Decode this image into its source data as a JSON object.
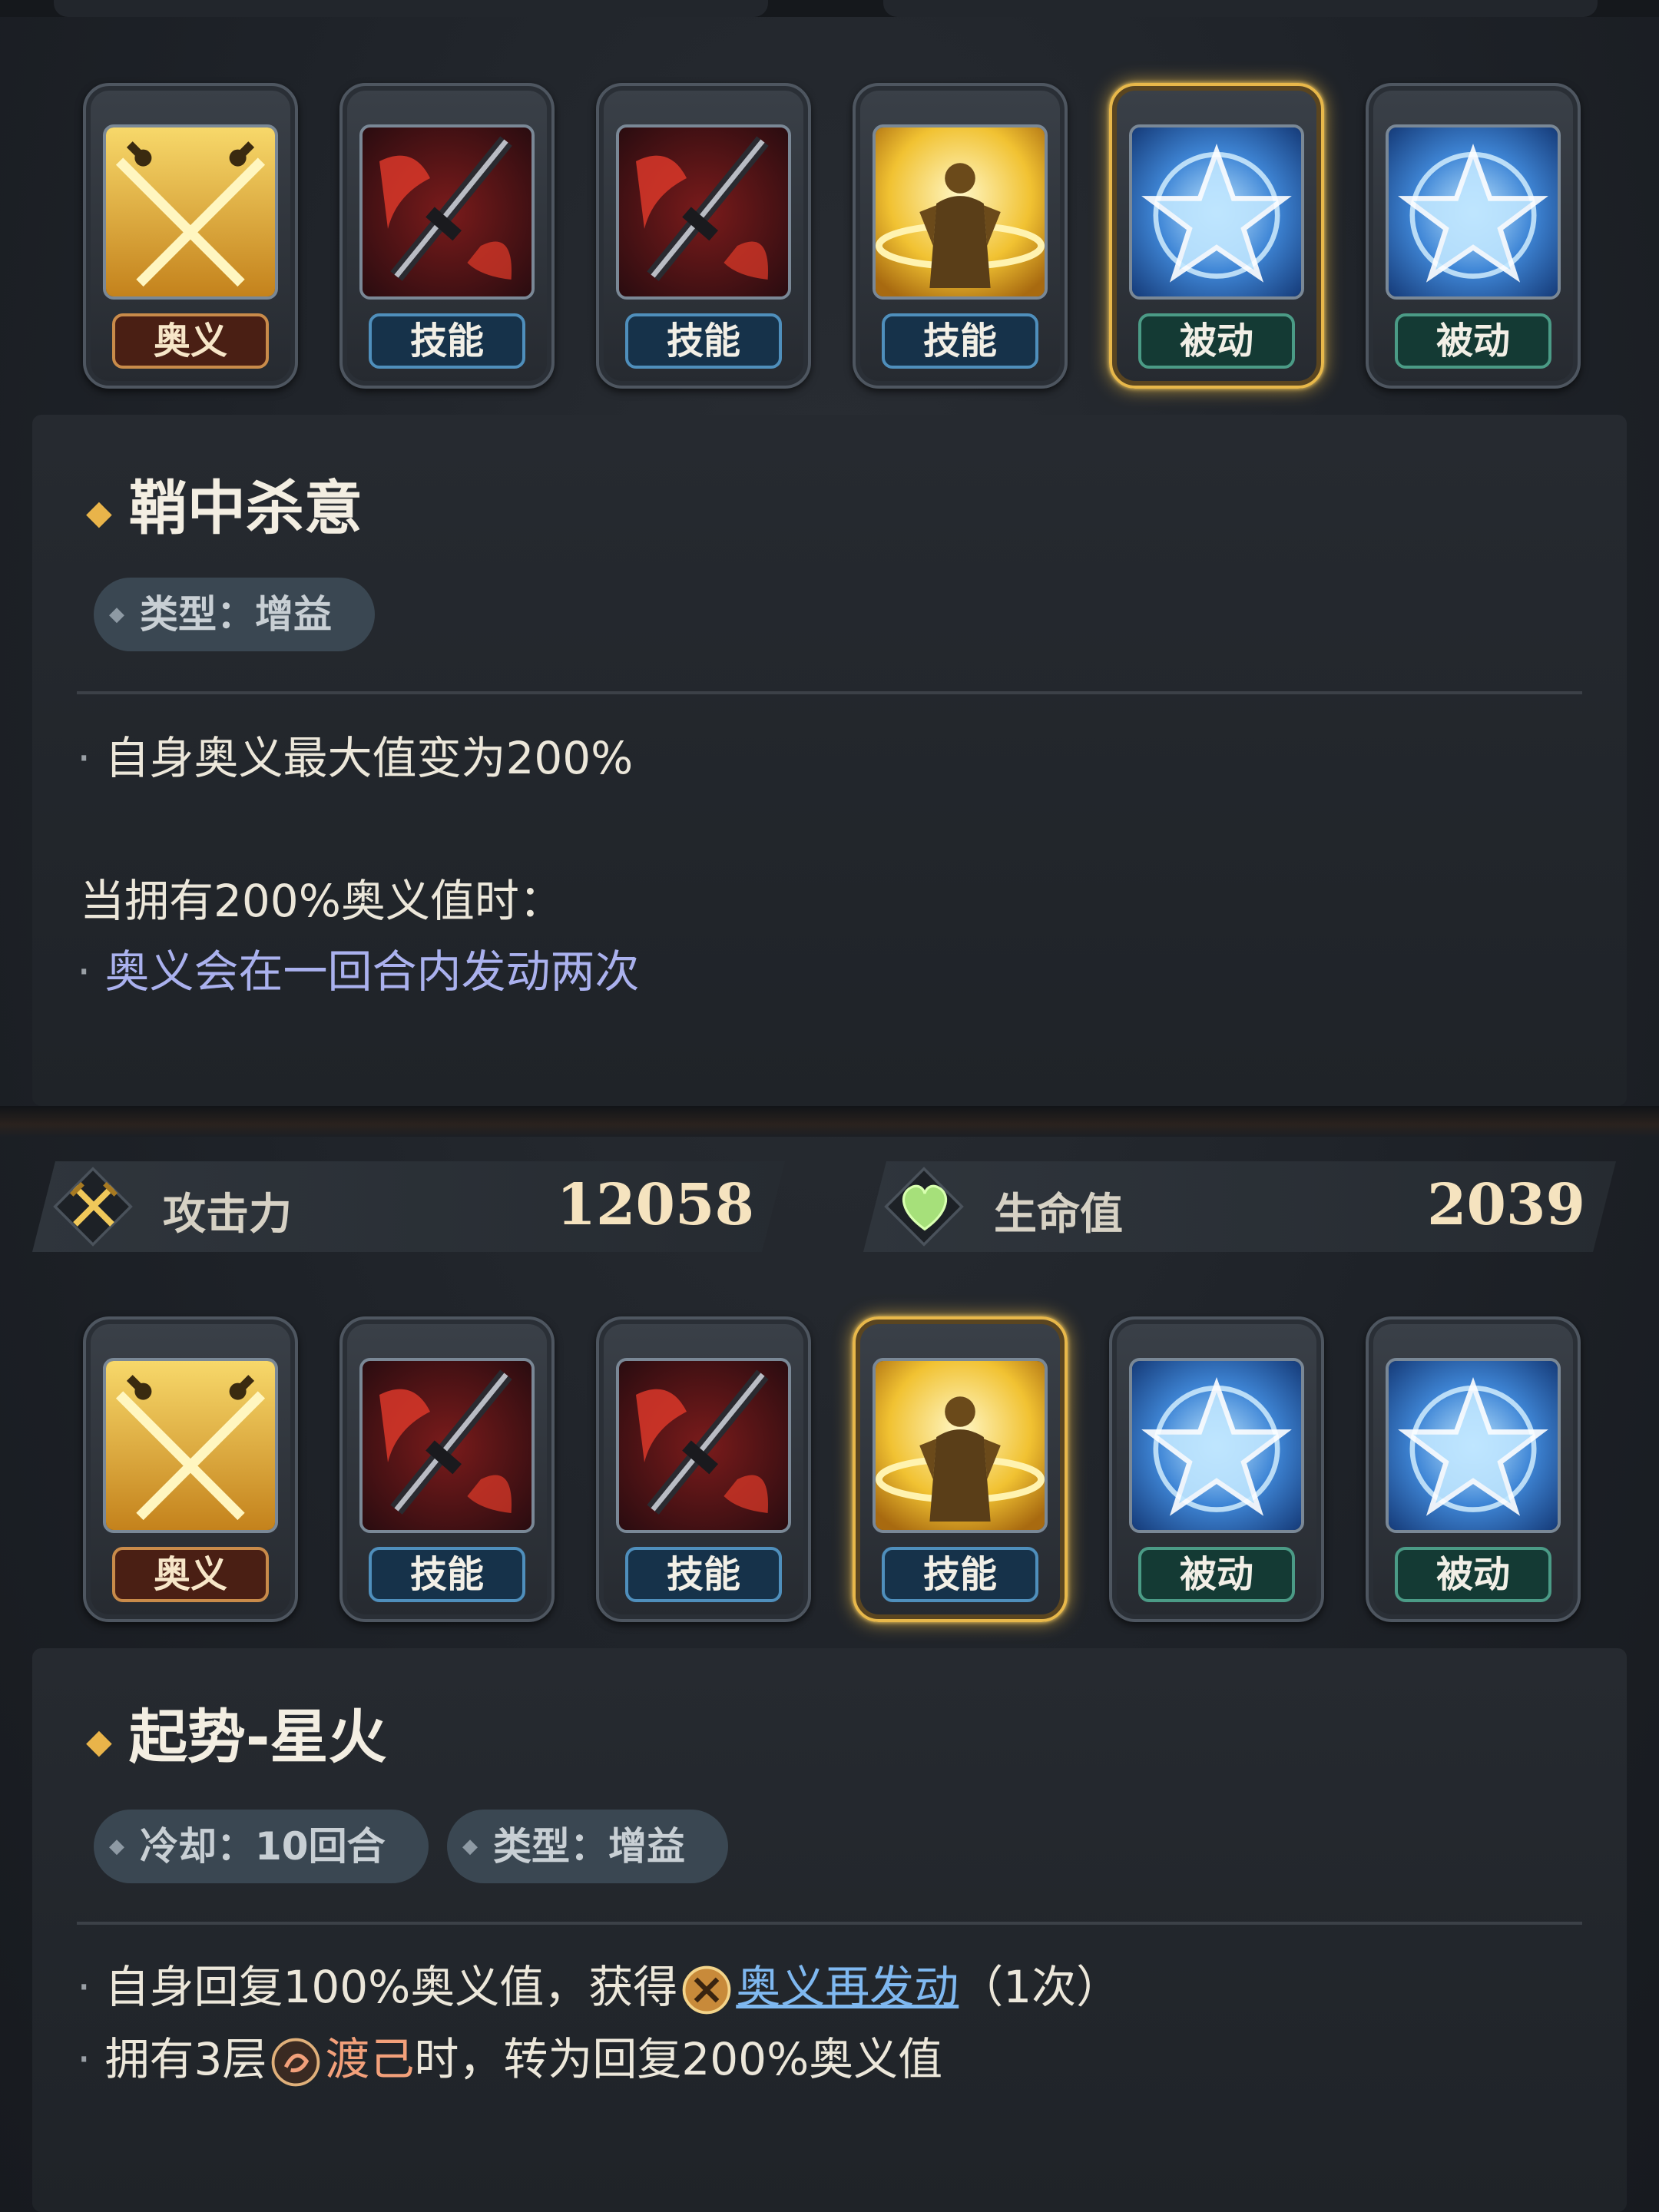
{
  "top_panel": {
    "skills": [
      {
        "icon": "crossed-swords-icon",
        "tag": "奥义",
        "kind": "ougi",
        "selected": false
      },
      {
        "icon": "red-greatsword-icon",
        "tag": "技能",
        "kind": "skill",
        "selected": false
      },
      {
        "icon": "red-greatsword-icon",
        "tag": "技能",
        "kind": "skill",
        "selected": false
      },
      {
        "icon": "golden-warrior-icon",
        "tag": "技能",
        "kind": "skill",
        "selected": false
      },
      {
        "icon": "blue-star-icon",
        "tag": "被动",
        "kind": "passive",
        "selected": true
      },
      {
        "icon": "blue-star-icon",
        "tag": "被动",
        "kind": "passive",
        "selected": false
      }
    ],
    "detail": {
      "title": "鞘中杀意",
      "type_chip": "类型：增益",
      "line1": "自身奥义最大值变为200%",
      "line2": "当拥有200%奥义值时：",
      "line3": "奥义会在一回合内发动两次"
    }
  },
  "stats": {
    "attack_label": "攻击力",
    "attack_value": "12058",
    "hp_label": "生命值",
    "hp_value": "2039"
  },
  "bottom_panel": {
    "skills": [
      {
        "icon": "crossed-swords-icon",
        "tag": "奥义",
        "kind": "ougi",
        "selected": false
      },
      {
        "icon": "red-greatsword-icon",
        "tag": "技能",
        "kind": "skill",
        "selected": false
      },
      {
        "icon": "red-greatsword-icon",
        "tag": "技能",
        "kind": "skill",
        "selected": false
      },
      {
        "icon": "golden-warrior-icon",
        "tag": "技能",
        "kind": "skill",
        "selected": true
      },
      {
        "icon": "blue-star-icon",
        "tag": "被动",
        "kind": "passive",
        "selected": false
      },
      {
        "icon": "blue-star-icon",
        "tag": "被动",
        "kind": "passive",
        "selected": false
      }
    ],
    "detail": {
      "title": "起势-星火",
      "cooldown_chip": "冷却：10回合",
      "type_chip": "类型：增益",
      "line1_prefix": "自身回复100%奥义值，获得",
      "line1_link": "奥义再发动",
      "line1_suffix": "（1次）",
      "line2_prefix": "拥有3层",
      "line2_keyword": "渡己",
      "line2_suffix": "时，转为回复200%奥义值"
    }
  }
}
